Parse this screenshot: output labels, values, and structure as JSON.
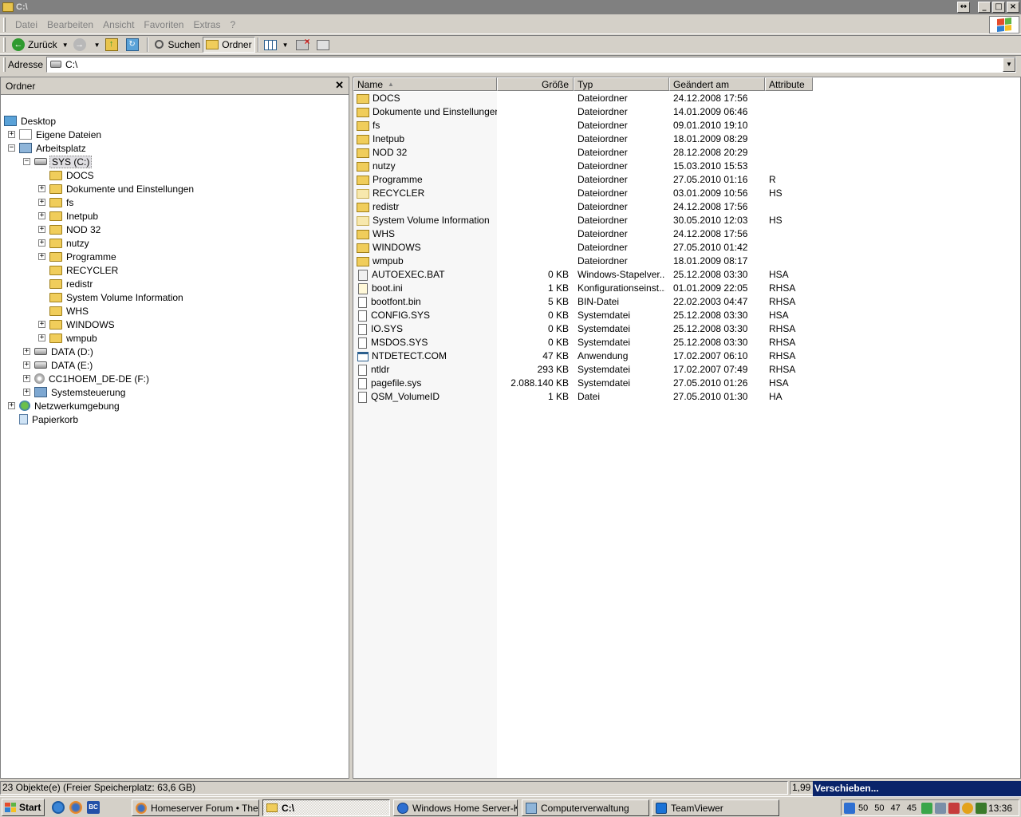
{
  "window": {
    "title": "C:\\"
  },
  "menu": [
    "Datei",
    "Bearbeiten",
    "Ansicht",
    "Favoriten",
    "Extras",
    "?"
  ],
  "toolbar": {
    "back_label": "Zurück",
    "search_label": "Suchen",
    "folders_label": "Ordner"
  },
  "address": {
    "label": "Adresse",
    "value": "C:\\"
  },
  "folder_pane": {
    "title": "Ordner",
    "tree": [
      {
        "label": "Desktop",
        "icon": "desktop-icon"
      },
      {
        "label": "Eigene Dateien",
        "icon": "my-documents-icon"
      },
      {
        "label": "Arbeitsplatz",
        "icon": "computer-icon"
      },
      {
        "label": "SYS (C:)",
        "icon": "drive-icon"
      },
      {
        "label": "DOCS",
        "icon": "folder-icon"
      },
      {
        "label": "Dokumente und Einstellungen",
        "icon": "folder-icon"
      },
      {
        "label": "fs",
        "icon": "folder-icon"
      },
      {
        "label": "Inetpub",
        "icon": "folder-icon"
      },
      {
        "label": "NOD 32",
        "icon": "folder-icon"
      },
      {
        "label": "nutzy",
        "icon": "folder-icon"
      },
      {
        "label": "Programme",
        "icon": "folder-icon"
      },
      {
        "label": "RECYCLER",
        "icon": "folder-icon"
      },
      {
        "label": "redistr",
        "icon": "folder-icon"
      },
      {
        "label": "System Volume Information",
        "icon": "folder-icon"
      },
      {
        "label": "WHS",
        "icon": "folder-icon"
      },
      {
        "label": "WINDOWS",
        "icon": "folder-icon"
      },
      {
        "label": "wmpub",
        "icon": "folder-icon"
      },
      {
        "label": "DATA (D:)",
        "icon": "drive-icon"
      },
      {
        "label": "DATA (E:)",
        "icon": "drive-icon"
      },
      {
        "label": "CC1HOEM_DE-DE (F:)",
        "icon": "cd-drive-icon"
      },
      {
        "label": "Systemsteuerung",
        "icon": "control-panel-icon"
      },
      {
        "label": "Netzwerkumgebung",
        "icon": "network-icon"
      },
      {
        "label": "Papierkorb",
        "icon": "recycle-bin-icon"
      }
    ]
  },
  "file_list": {
    "columns": {
      "name": "Name",
      "size": "Größe",
      "type": "Typ",
      "modified": "Geändert am",
      "attributes": "Attribute"
    },
    "rows": [
      {
        "name": "DOCS",
        "size": "",
        "type": "Dateiordner",
        "modified": "24.12.2008 17:56",
        "attr": "",
        "icon": "folder-icon"
      },
      {
        "name": "Dokumente und Einstellungen",
        "size": "",
        "type": "Dateiordner",
        "modified": "14.01.2009 06:46",
        "attr": "",
        "icon": "folder-icon"
      },
      {
        "name": "fs",
        "size": "",
        "type": "Dateiordner",
        "modified": "09.01.2010 19:10",
        "attr": "",
        "icon": "folder-icon"
      },
      {
        "name": "Inetpub",
        "size": "",
        "type": "Dateiordner",
        "modified": "18.01.2009 08:29",
        "attr": "",
        "icon": "folder-icon"
      },
      {
        "name": "NOD 32",
        "size": "",
        "type": "Dateiordner",
        "modified": "28.12.2008 20:29",
        "attr": "",
        "icon": "folder-icon"
      },
      {
        "name": "nutzy",
        "size": "",
        "type": "Dateiordner",
        "modified": "15.03.2010 15:53",
        "attr": "",
        "icon": "folder-icon"
      },
      {
        "name": "Programme",
        "size": "",
        "type": "Dateiordner",
        "modified": "27.05.2010 01:16",
        "attr": "R",
        "icon": "folder-icon"
      },
      {
        "name": "RECYCLER",
        "size": "",
        "type": "Dateiordner",
        "modified": "03.01.2009 10:56",
        "attr": "HS",
        "icon": "hidden-folder-icon"
      },
      {
        "name": "redistr",
        "size": "",
        "type": "Dateiordner",
        "modified": "24.12.2008 17:56",
        "attr": "",
        "icon": "folder-icon"
      },
      {
        "name": "System Volume Information",
        "size": "",
        "type": "Dateiordner",
        "modified": "30.05.2010 12:03",
        "attr": "HS",
        "icon": "hidden-folder-icon"
      },
      {
        "name": "WHS",
        "size": "",
        "type": "Dateiordner",
        "modified": "24.12.2008 17:56",
        "attr": "",
        "icon": "folder-icon"
      },
      {
        "name": "WINDOWS",
        "size": "",
        "type": "Dateiordner",
        "modified": "27.05.2010 01:42",
        "attr": "",
        "icon": "folder-icon"
      },
      {
        "name": "wmpub",
        "size": "",
        "type": "Dateiordner",
        "modified": "18.01.2009 08:17",
        "attr": "",
        "icon": "folder-icon"
      },
      {
        "name": "AUTOEXEC.BAT",
        "size": "0 KB",
        "type": "Windows-Stapelver...",
        "modified": "25.12.2008 03:30",
        "attr": "HSA",
        "icon": "batch-file-icon"
      },
      {
        "name": "boot.ini",
        "size": "1 KB",
        "type": "Konfigurationseinst...",
        "modified": "01.01.2009 22:05",
        "attr": "RHSA",
        "icon": "ini-file-icon"
      },
      {
        "name": "bootfont.bin",
        "size": "5 KB",
        "type": "BIN-Datei",
        "modified": "22.02.2003 04:47",
        "attr": "RHSA",
        "icon": "file-icon"
      },
      {
        "name": "CONFIG.SYS",
        "size": "0 KB",
        "type": "Systemdatei",
        "modified": "25.12.2008 03:30",
        "attr": "HSA",
        "icon": "system-file-icon"
      },
      {
        "name": "IO.SYS",
        "size": "0 KB",
        "type": "Systemdatei",
        "modified": "25.12.2008 03:30",
        "attr": "RHSA",
        "icon": "system-file-icon"
      },
      {
        "name": "MSDOS.SYS",
        "size": "0 KB",
        "type": "Systemdatei",
        "modified": "25.12.2008 03:30",
        "attr": "RHSA",
        "icon": "system-file-icon"
      },
      {
        "name": "NTDETECT.COM",
        "size": "47 KB",
        "type": "Anwendung",
        "modified": "17.02.2007 06:10",
        "attr": "RHSA",
        "icon": "application-icon"
      },
      {
        "name": "ntldr",
        "size": "293 KB",
        "type": "Systemdatei",
        "modified": "17.02.2007 07:49",
        "attr": "RHSA",
        "icon": "system-file-icon"
      },
      {
        "name": "pagefile.sys",
        "size": "2.088.140 KB",
        "type": "Systemdatei",
        "modified": "27.05.2010 01:26",
        "attr": "HSA",
        "icon": "system-file-icon"
      },
      {
        "name": "QSM_VolumeID",
        "size": "1 KB",
        "type": "Datei",
        "modified": "27.05.2010 01:30",
        "attr": "HA",
        "icon": "file-icon"
      }
    ]
  },
  "status": {
    "main": "23 Objekte(e) (Freier Speicherplatz: 63,6 GB)",
    "size": "1,99",
    "tip": "Verschieben..."
  },
  "taskbar": {
    "start_label": "Start",
    "tasks": [
      {
        "label": "Homeserver Forum • The...",
        "icon": "firefox-icon"
      },
      {
        "label": "C:\\",
        "icon": "folder-icon"
      },
      {
        "label": "Windows Home Server-K...",
        "icon": "whs-console-icon"
      },
      {
        "label": "Computerverwaltung",
        "icon": "computer-management-icon"
      },
      {
        "label": "TeamViewer",
        "icon": "teamviewer-icon"
      }
    ],
    "tray_values": [
      "50",
      "50",
      "47",
      "45"
    ],
    "clock": "13:36"
  }
}
